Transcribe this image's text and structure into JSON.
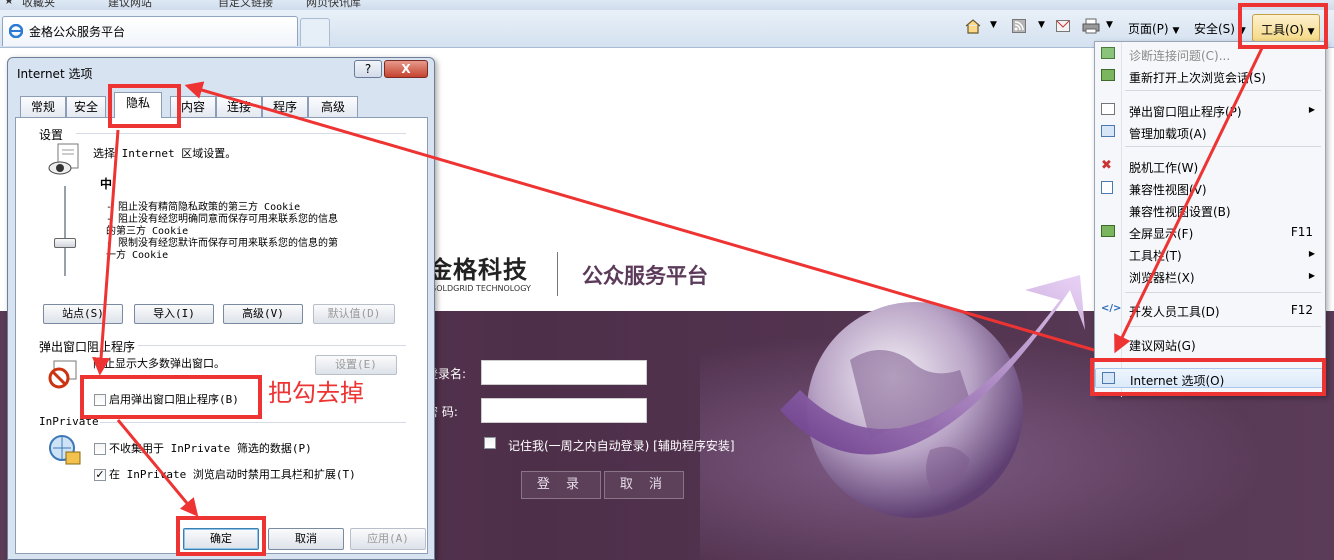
{
  "favorites_bar": {
    "favorites": "收藏夹",
    "suggested_sites": "建议网站",
    "custom_links": "自定义链接",
    "web_slice_gallery": "网页快讯库"
  },
  "tab": {
    "title": "金格公众服务平台"
  },
  "command_bar": {
    "page": "页面(P)",
    "safety": "安全(S)",
    "tools": "工具(O)"
  },
  "tools_menu": {
    "items": [
      {
        "label": "诊断连接问题(C)...",
        "enabled": false
      },
      {
        "label": "重新打开上次浏览会话(S)"
      },
      {
        "label": "弹出窗口阻止程序(P)",
        "submenu": true
      },
      {
        "label": "管理加载项(A)"
      },
      {
        "label": "脱机工作(W)"
      },
      {
        "label": "兼容性视图(V)"
      },
      {
        "label": "兼容性视图设置(B)"
      },
      {
        "label": "全屏显示(F)",
        "shortcut": "F11"
      },
      {
        "label": "工具栏(T)",
        "submenu": true
      },
      {
        "label": "浏览器栏(X)",
        "submenu": true
      },
      {
        "label": "开发人员工具(D)",
        "shortcut": "F12"
      },
      {
        "label": "建议网站(G)"
      },
      {
        "label": "Internet 选项(O)"
      }
    ]
  },
  "website": {
    "logo": "金格科技",
    "logo_sub": "GOLDGRID TECHNOLOGY",
    "platform": "公众服务平台",
    "login": {
      "username_label": "登录名:",
      "password_label": "密  码:",
      "remember_label": "记住我(一周之内自动登录) [辅助程序安装]",
      "login_button": "登 录",
      "cancel_button": "取 消"
    }
  },
  "dialog": {
    "title": "Internet 选项",
    "help": "?",
    "close": "X",
    "tabs": [
      "常规",
      "安全",
      "隐私",
      "内容",
      "连接",
      "程序",
      "高级"
    ],
    "selected_tab": "隐私",
    "settings_group": "设置",
    "zone_prompt": "选择 Internet 区域设置。",
    "level": "中",
    "level_lines": [
      "- 阻止没有精简隐私政策的第三方 Cookie",
      "- 阻止没有经您明确同意而保存可用来联系您的信息",
      "的第三方 Cookie",
      "- 限制没有经您默许而保存可用来联系您的信息的第",
      "一方 Cookie"
    ],
    "buttons": {
      "sites": "站点(S)",
      "import": "导入(I)",
      "advanced": "高级(V)",
      "default": "默认值(D)"
    },
    "popup_group": "弹出窗口阻止程序",
    "popup_desc": "阻止显示大多数弹出窗口。",
    "popup_settings": "设置(E)",
    "popup_checkbox": {
      "label": "启用弹出窗口阻止程序(B)",
      "checked": false
    },
    "inprivate_group": "InPrivate",
    "inprivate_check1": {
      "label": "不收集用于 InPrivate 筛选的数据(P)",
      "checked": false
    },
    "inprivate_check2": {
      "label": "在 InPrivate 浏览启动时禁用工具栏和扩展(T)",
      "checked": true
    },
    "footer": {
      "ok": "确定",
      "cancel": "取消",
      "apply": "应用(A)"
    }
  },
  "annotation": {
    "text": "把勾去掉",
    "color": "#ee3333"
  },
  "colors": {
    "band": "#533550",
    "accent_red": "#ee3333",
    "platform_purple": "#5b3a5a"
  }
}
